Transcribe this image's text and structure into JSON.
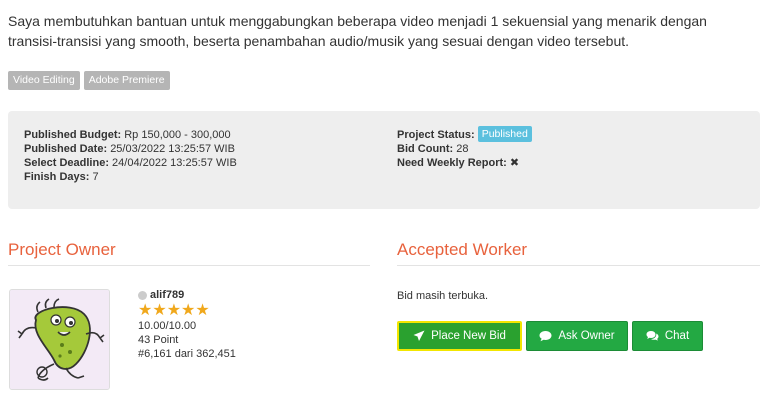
{
  "project": {
    "description": "Saya membutuhkan bantuan untuk menggabungkan beberapa video menjadi 1 sekuensial yang menarik dengan transisi-transisi yang smooth, beserta penambahan audio/musik yang sesuai dengan video tersebut.",
    "tags": [
      "Video Editing",
      "Adobe Premiere"
    ]
  },
  "info": {
    "budget_label": "Published Budget:",
    "budget_value": "Rp 150,000 - 300,000",
    "date_label": "Published Date:",
    "date_value": "25/03/2022 13:25:57 WIB",
    "deadline_label": "Select Deadline:",
    "deadline_value": "24/04/2022 13:25:57 WIB",
    "finish_label": "Finish Days:",
    "finish_value": "7",
    "status_label": "Project Status:",
    "status_value": "Published",
    "bidcount_label": "Bid Count:",
    "bidcount_value": "28",
    "weekly_label": "Need Weekly Report:",
    "weekly_icon": "times-icon"
  },
  "owner": {
    "section_title": "Project Owner",
    "username": "alif789",
    "stars": "★★★★★",
    "rating": "10.00/10.00",
    "points": "43 Point",
    "rank": "#6,161 dari 362,451",
    "star_color": "#f0a81c",
    "online_dot_color": "#cccccc"
  },
  "worker": {
    "section_title": "Accepted Worker",
    "status_text": "Bid masih terbuka."
  },
  "buttons": {
    "place_bid": "Place New Bid",
    "ask_owner": "Ask Owner",
    "chat": "Chat"
  },
  "colors": {
    "accent_title": "#e8623d",
    "button_green": "#23a943",
    "highlight_border": "#f2e600",
    "badge_published": "#5bc0de"
  }
}
